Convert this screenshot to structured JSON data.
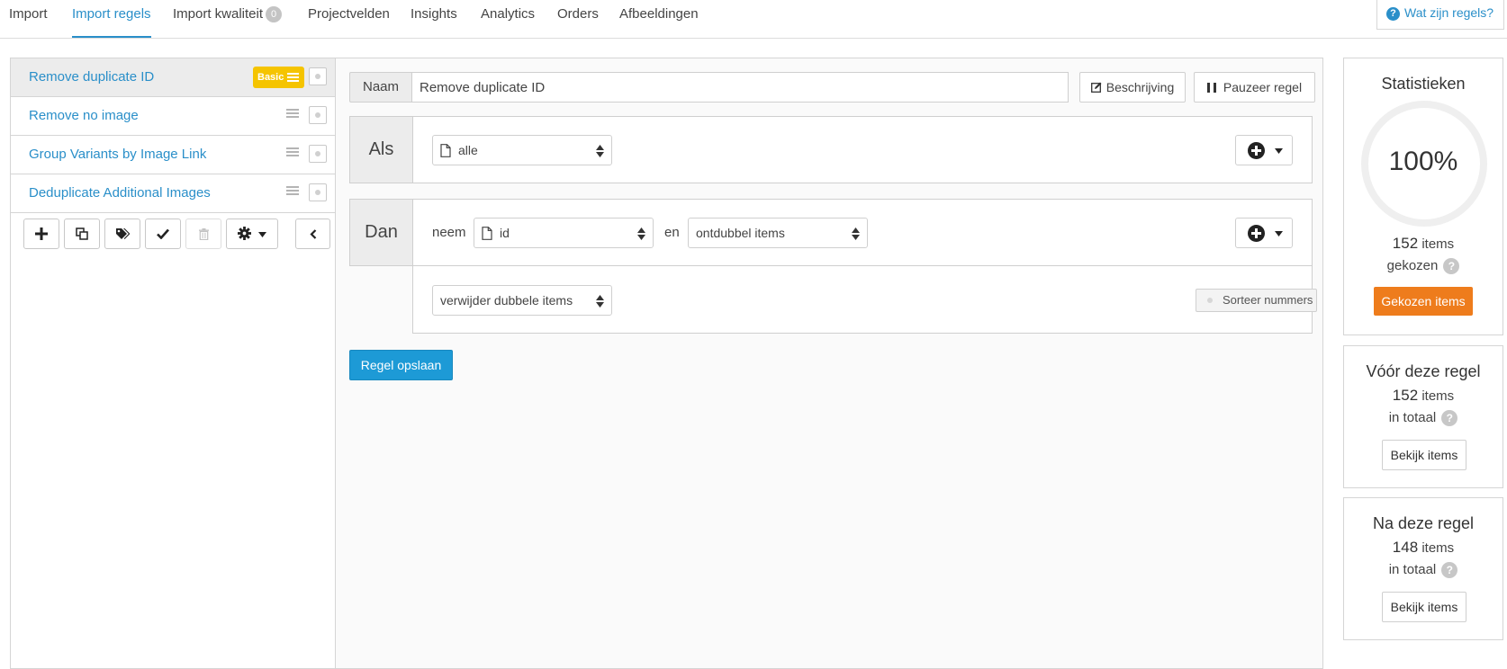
{
  "nav": {
    "tabs": [
      {
        "label": "Import"
      },
      {
        "label": "Import regels"
      },
      {
        "label": "Import kwaliteit",
        "badge": "0"
      },
      {
        "label": "Projectvelden"
      },
      {
        "label": "Insights"
      },
      {
        "label": "Analytics"
      },
      {
        "label": "Orders"
      },
      {
        "label": "Afbeeldingen"
      }
    ],
    "active_tab": "Import regels",
    "help_label": "Wat zijn regels?"
  },
  "rules": {
    "items": [
      {
        "label": "Remove duplicate ID",
        "tag": "Basic",
        "active": true
      },
      {
        "label": "Remove no image"
      },
      {
        "label": "Group Variants by Image Link"
      },
      {
        "label": "Deduplicate Additional Images"
      }
    ],
    "toolbar_icons": [
      "plus-icon",
      "copy-icon",
      "tags-icon",
      "check-icon",
      "trash-icon",
      "gear-icon",
      "chevron-left-icon"
    ]
  },
  "editor": {
    "name_label": "Naam",
    "name_value": "Remove duplicate ID",
    "description_label": "Beschrijving",
    "pause_label": "Pauzeer regel",
    "if_label": "Als",
    "if_select": "alle",
    "then_label": "Dan",
    "take_word": "neem",
    "field_select": "id",
    "and_word": "en",
    "action_select": "ontdubbel items",
    "mode_select": "verwijder dubbele items",
    "sort_label": "Sorteer nummers",
    "save_label": "Regel opslaan"
  },
  "stats": {
    "title": "Statistieken",
    "percent": "100%",
    "percent_value": 1.0,
    "count": "152",
    "items_word": "items",
    "chosen_word": "gekozen",
    "chosen_button": "Gekozen items",
    "before": {
      "title": "Vóór deze regel",
      "count": "152",
      "items_word": "items",
      "total_word": "in totaal",
      "button": "Bekijk items"
    },
    "after": {
      "title": "Na deze regel",
      "count": "148",
      "items_word": "items",
      "total_word": "in totaal",
      "button": "Bekijk items"
    }
  },
  "colors": {
    "accent": "#2a8fc9",
    "primary_button": "#1d9ad6",
    "orange_button": "#ee7c1c",
    "basic_tag": "#f5c400"
  }
}
